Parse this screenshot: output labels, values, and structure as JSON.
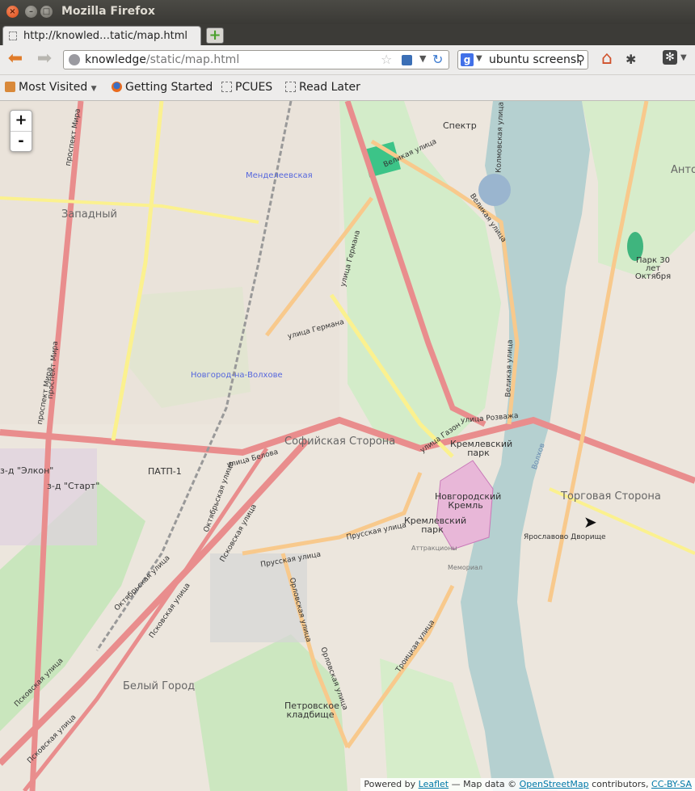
{
  "window": {
    "title": "Mozilla Firefox"
  },
  "tabs": [
    {
      "label": "http://knowled…tatic/map.html",
      "active": true
    }
  ],
  "navbar": {
    "url_host": "knowledge",
    "url_path": "/static/map.html",
    "search_value": "ubuntu screensl",
    "search_engine": "Google"
  },
  "bookmarks": [
    {
      "label": "Most Visited",
      "icon": "most-visited-icon",
      "dropdown": true
    },
    {
      "label": "Getting Started",
      "icon": "firefox-icon"
    },
    {
      "label": "PCUES",
      "icon": "bookmark-blank-icon"
    },
    {
      "label": "Read Later",
      "icon": "bookmark-blank-icon"
    }
  ],
  "map": {
    "zoom_in": "+",
    "zoom_out": "-",
    "labels": {
      "spektr": "Спектр",
      "zapadny": "Западный",
      "mendeleevskaya": "Менделеевская",
      "novgorod_station": "Новгород-на-Волхове",
      "sofiyskaya": "Софийская Сторона",
      "torgovaya": "Торговая Сторона",
      "kremlevsky_park1": "Кремлевский парк",
      "kremlevsky_park2": "Кремлевский парк",
      "kremlin": "Новгородский Кремль",
      "yaroslavovo": "Ярославово Дворище",
      "belyi_gorod": "Белый Город",
      "petrovskoe": "Петровское кладбище",
      "park_30": "Парк 30 лет Октября",
      "patp": "ПАТП-1",
      "elkon": "з-д \"Элкон\"",
      "start": "з-д \"Старт\"",
      "anton": "Анто",
      "attractions": "Аттракционы",
      "memorial": "Мемориал",
      "volkhov": "Волхов"
    },
    "streets": {
      "velikaya1": "Великая улица",
      "velikaya2": "Великая улица",
      "velikaya3": "Великая улица",
      "rozvazha": "улица Розважа",
      "germana1": "улица Германа",
      "germana2": "улица Германа",
      "gazon": "улица Газон",
      "belova": "улица Белова",
      "prusskaya1": "Прусская улица",
      "prusskaya2": "Прусская улица",
      "oktyabrskaya1": "Октябрьская улица",
      "oktyabrskaya2": "Октябрьская улица",
      "pskovskaya1": "Псковская улица",
      "pskovskaya2": "Псковская улица",
      "pskovskaya3": "Псковская улица",
      "pskovskaya4": "Псковская улица",
      "orlovskaya1": "Орловская улица",
      "orlovskaya2": "Орловская улица",
      "troitskaya": "Троицкая улица",
      "prospekt_mira1": "проспект Мира",
      "prospekt_mira2": "проспект Мира",
      "prospekt_mira3": "проспект Мира",
      "kolmovskaya": "Колмовская улица"
    },
    "attribution": {
      "powered": "Powered by",
      "leaflet": "Leaflet",
      "map_data": "— Map data ©",
      "osm": "OpenStreetMap",
      "contributors": "contributors,",
      "license": "CC-BY-SA"
    }
  }
}
